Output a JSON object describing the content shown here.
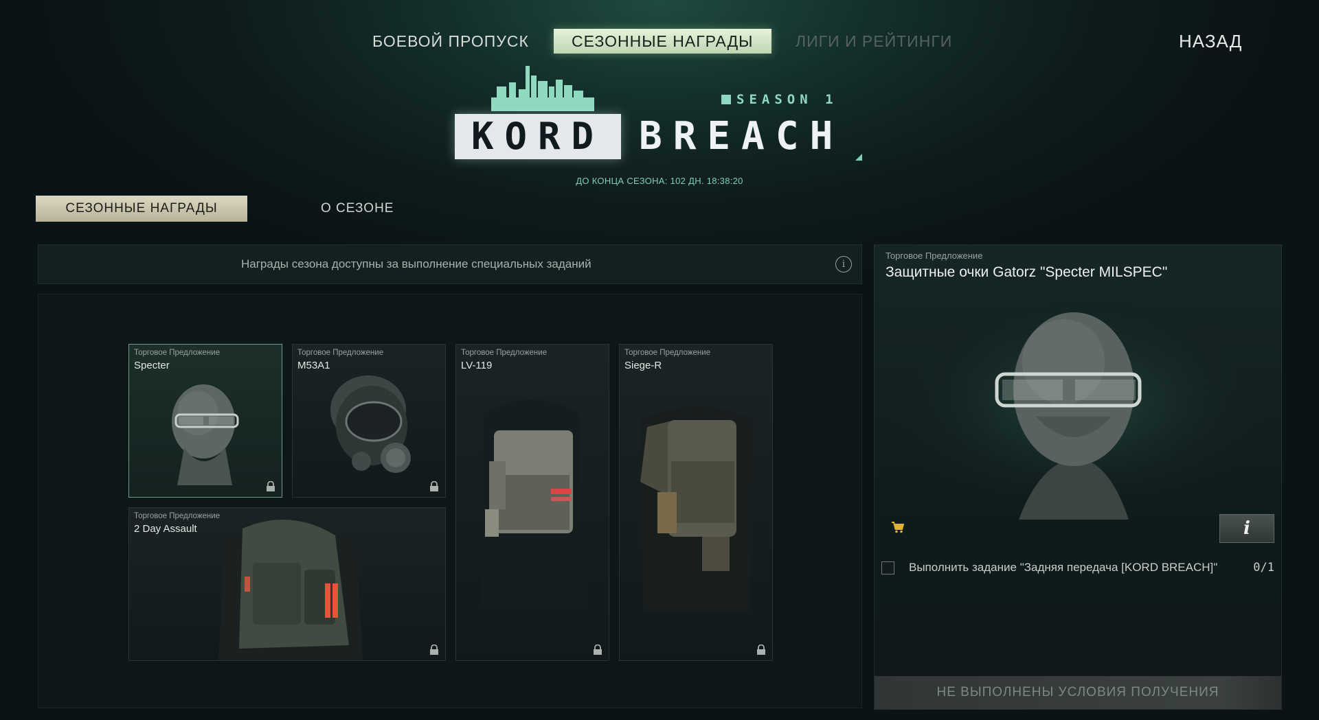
{
  "top_nav": {
    "tabs": [
      {
        "label": "БОЕВОЙ ПРОПУСК",
        "state": "normal"
      },
      {
        "label": "СЕЗОННЫЕ НАГРАДЫ",
        "state": "active"
      },
      {
        "label": "ЛИГИ И РЕЙТИНГИ",
        "state": "disabled"
      }
    ],
    "back_label": "НАЗАД"
  },
  "logo": {
    "season": "SEASON 1",
    "word1": "KORD",
    "word2": "BREACH"
  },
  "countdown": "ДО КОНЦА СЕЗОНА: 102 ДН. 18:38:20",
  "sub_tabs": {
    "active": "СЕЗОННЫЕ НАГРАДЫ",
    "other": "О СЕЗОНЕ"
  },
  "info_bar": {
    "text": "Награды сезона доступны за выполнение специальных заданий",
    "icon": "info-icon"
  },
  "rewards": [
    {
      "tag": "Торговое Предложение",
      "name": "Specter",
      "item": "glasses-head",
      "locked": true,
      "selected": true
    },
    {
      "tag": "Торговое Предложение",
      "name": "M53A1",
      "item": "gas-mask",
      "locked": true,
      "selected": false
    },
    {
      "tag": "Торговое Предложение",
      "name": "LV-119",
      "item": "plate-carrier",
      "locked": true,
      "selected": false
    },
    {
      "tag": "Торговое Предложение",
      "name": "Siege-R",
      "item": "body-armor",
      "locked": true,
      "selected": false
    },
    {
      "tag": "Торговое Предложение",
      "name": "2 Day Assault",
      "item": "backpack",
      "locked": true,
      "selected": false
    }
  ],
  "detail": {
    "tag": "Торговое Предложение",
    "title": "Защитные очки Gatorz \"Specter MILSPEC\"",
    "task": "Выполнить задание \"Задняя передача [KORD BREACH]\"",
    "progress": "0/1",
    "status": "НЕ ВЫПОЛНЕНЫ УСЛОВИЯ ПОЛУЧЕНИЯ",
    "cart_icon": "cart-icon",
    "info_icon": "info-icon"
  },
  "colors": {
    "accent_tab": "#d3e6c9",
    "sub_tab_active": "#cdc8b0",
    "teal_text": "#7fcfb5",
    "cart": "#e0b42a"
  }
}
